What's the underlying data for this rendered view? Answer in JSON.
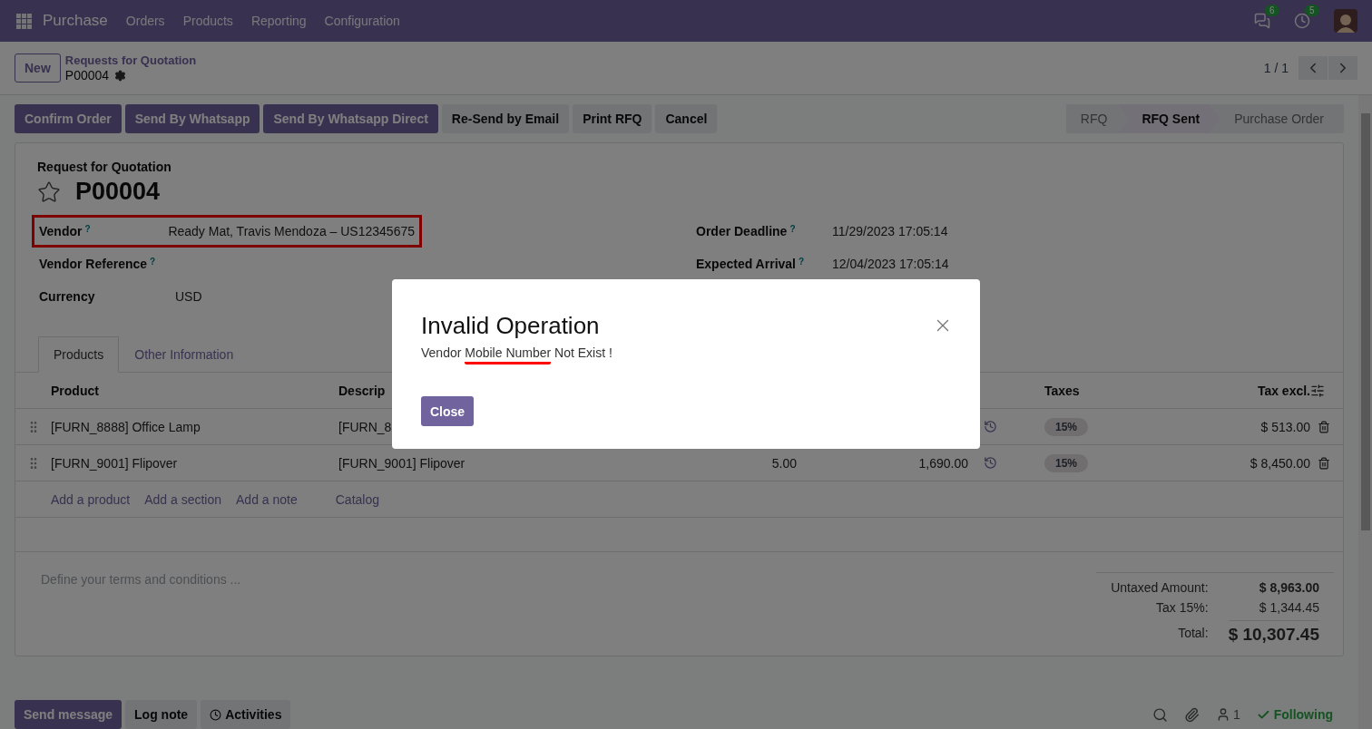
{
  "navbar": {
    "app": "Purchase",
    "menu": [
      "Orders",
      "Products",
      "Reporting",
      "Configuration"
    ],
    "messages_badge": "6",
    "activities_badge": "5"
  },
  "control_panel": {
    "new_button": "New",
    "breadcrumb": "Requests for Quotation",
    "record": "P00004",
    "pager": "1 / 1"
  },
  "actions": [
    {
      "label": "Confirm Order",
      "kind": "primary"
    },
    {
      "label": "Send By Whatsapp",
      "kind": "primary"
    },
    {
      "label": "Send By Whatsapp Direct",
      "kind": "primary"
    },
    {
      "label": "Re-Send by Email",
      "kind": "secondary"
    },
    {
      "label": "Print RFQ",
      "kind": "secondary"
    },
    {
      "label": "Cancel",
      "kind": "secondary"
    }
  ],
  "statusbar": [
    {
      "label": "RFQ",
      "selected": false
    },
    {
      "label": "RFQ Sent",
      "selected": true
    },
    {
      "label": "Purchase Order",
      "selected": false
    }
  ],
  "sheet": {
    "subtitle": "Request for Quotation",
    "title": "P00004",
    "starred": false,
    "left_fields": [
      {
        "label": "Vendor",
        "help": "?",
        "value": "Ready Mat, Travis Mendoza – US12345675",
        "highlighted": true
      },
      {
        "label": "Vendor Reference",
        "help": "?",
        "highlighted": false
      },
      {
        "label": "Currency",
        "value": "USD",
        "highlighted": false
      }
    ],
    "right_fields": [
      {
        "label": "Order Deadline",
        "help": "?",
        "value": "11/29/2023 17:05:14",
        "highlighted": false
      },
      {
        "label": "Expected Arrival",
        "help": "?",
        "value": "12/04/2023 17:05:14",
        "highlighted": false
      }
    ],
    "tabs": [
      {
        "label": "Products",
        "selected": true
      },
      {
        "label": "Other Information",
        "selected": false
      }
    ],
    "table": {
      "columns": [
        "Product",
        "Descrip",
        "",
        "",
        "",
        "Taxes",
        "Tax excl."
      ],
      "rows": [
        {
          "product": "[FURN_8888] Office Lamp",
          "description": "[FURN_8",
          "tax": "15%",
          "subtotal": "$ 513.00"
        },
        {
          "product": "[FURN_9001] Flipover",
          "description": "[FURN_9001] Flipover",
          "quantity": "5.00",
          "price": "1,690.00",
          "tax": "15%",
          "subtotal": "$ 8,450.00"
        }
      ],
      "add_links": [
        "Add a product",
        "Add a section",
        "Add a note",
        "Catalog"
      ]
    },
    "terms": {
      "placeholder": "Define your terms and conditions ..."
    },
    "totals": [
      {
        "label": "Untaxed Amount:",
        "value": "$ 8,963.00",
        "kind": "strong"
      },
      {
        "label": "Tax 15%:",
        "value": "$ 1,344.45",
        "kind": "plain"
      },
      {
        "label": "Total:",
        "value": "$ 10,307.45",
        "kind": "total"
      }
    ]
  },
  "chatter": {
    "buttons": [
      {
        "label": "Send message",
        "kind": "primary"
      },
      {
        "label": "Log note",
        "kind": "secondary"
      },
      {
        "label": "Activities",
        "kind": "activities"
      }
    ],
    "followers": "1",
    "following": "Following"
  },
  "dialog": {
    "title": "Invalid Operation",
    "message": [
      {
        "text": "Vendor ",
        "underlined": false
      },
      {
        "text": "Mobile Number",
        "underlined": true
      },
      {
        "text": " Not Exist !",
        "underlined": false
      }
    ],
    "close_button": "Close"
  }
}
